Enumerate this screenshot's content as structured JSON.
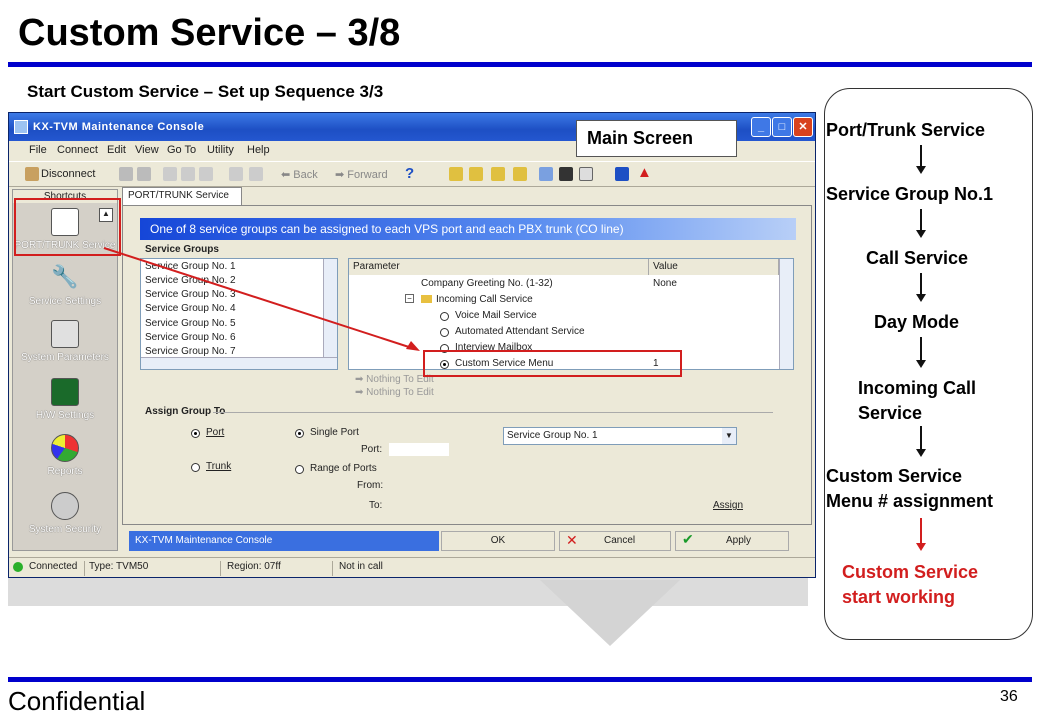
{
  "slide": {
    "title": "Custom Service – 3/8",
    "subtitle": "Start Custom Service – Set up Sequence 3/3",
    "footer_left": "Confidential",
    "page_number": "36",
    "callout": "Main Screen"
  },
  "window": {
    "title": "KX-TVM Maintenance Console",
    "menu": [
      "File",
      "Connect",
      "Edit",
      "View",
      "Go To",
      "Utility",
      "Help"
    ],
    "toolbar": {
      "disconnect": "Disconnect",
      "back": "Back",
      "forward": "Forward"
    },
    "sidebar_header": "Shortcuts",
    "sidebar_items": [
      "PORT/TRUNK Service",
      "Service Settings",
      "System Parameters",
      "H/W Settings",
      "Reports",
      "System Security"
    ],
    "tab": "PORT/TRUNK Service",
    "banner": "One of 8 service groups can be assigned to each VPS port and each PBX trunk (CO line)",
    "service_groups_label": "Service Groups",
    "service_groups": [
      "Service Group No. 1",
      "Service Group No. 2",
      "Service Group No. 3",
      "Service Group No. 4",
      "Service Group No. 5",
      "Service Group No. 6",
      "Service Group No. 7"
    ],
    "param_headers": {
      "parameter": "Parameter",
      "value": "Value"
    },
    "params": [
      {
        "label": "Company Greeting No. (1-32)",
        "value": "None"
      },
      {
        "label": "Incoming Call Service",
        "value": ""
      },
      {
        "label": "Voice Mail Service",
        "value": ""
      },
      {
        "label": "Automated Attendant Service",
        "value": ""
      },
      {
        "label": "Interview Mailbox",
        "value": ""
      },
      {
        "label": "Custom Service Menu",
        "value": "1"
      }
    ],
    "nothing_to_edit": "Nothing To Edit",
    "assign_group_to": "Assign Group To",
    "port": "Port",
    "trunk": "Trunk",
    "single_port": "Single Port",
    "range_of_ports": "Range of Ports",
    "port_field": "Port:",
    "from_field": "From:",
    "to_field": "To:",
    "group_select": "Service Group No. 1",
    "assign": "Assign",
    "footer_title": "KX-TVM Maintenance Console",
    "ok": "OK",
    "cancel": "Cancel",
    "apply": "Apply",
    "status": {
      "connected": "Connected",
      "type": "Type: TVM50",
      "region": "Region: 07ff",
      "call": "Not in call"
    }
  },
  "flow": {
    "steps": [
      "Port/Trunk Service",
      "Service Group No.1",
      "Call Service",
      "Day Mode",
      "Incoming Call\nService",
      "Custom Service\nMenu # assignment",
      "Custom Service\nstart working"
    ],
    "highlight_color": "#d21e1e"
  }
}
